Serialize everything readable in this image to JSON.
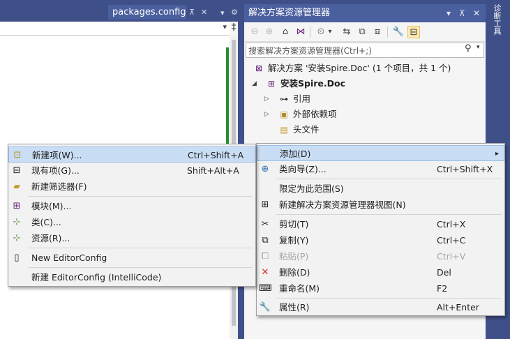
{
  "editor": {
    "tab_title": "packages.config",
    "pin_glyph": "⊼",
    "close_glyph": "✕",
    "tab_menu_glyph": "▾",
    "options_glyph": "⚙",
    "nav_dropdown_glyph": "▾",
    "split_glyph": "‡"
  },
  "solution_explorer": {
    "title": "解决方案资源管理器",
    "title_dropdown_glyph": "▾",
    "title_pin_glyph": "⊼",
    "title_close_glyph": "✕",
    "search_placeholder": "搜索解决方案资源管理器(Ctrl+;)",
    "search_icon_glyph": "⚲",
    "search_dropdown_glyph": "▾",
    "toolbar": {
      "back": "⊖",
      "forward": "⊕",
      "home": "⌂",
      "vs": "⋈",
      "dropdown1": "▾",
      "history": "⏲",
      "dropdown2": "▾",
      "sync": "⇆",
      "collapse": "⧉",
      "show_all": "⧈",
      "properties": "🔧",
      "preview": "⊟"
    },
    "tree": {
      "solution": "解决方案 '安装Spire.Doc' (1 个项目，共 1 个)",
      "project": "安装Spire.Doc",
      "references": "引用",
      "external_deps": "外部依赖项",
      "header_files": "头文件",
      "collapsed_arrow": "▷",
      "expanded_arrow": "◢",
      "icon_solution": "⊠",
      "icon_project": "⊞",
      "icon_refs": "⊶",
      "icon_extdeps": "▣",
      "icon_headers": "▤"
    }
  },
  "diagnostic_tab": "诊断工具",
  "context_menu": {
    "add": {
      "label": "添加(D)",
      "submenu_arrow": "▸"
    },
    "class_wizard": {
      "label": "类向导(Z)...",
      "shortcut": "Ctrl+Shift+X",
      "icon": "⊕"
    },
    "scope_here": {
      "label": "限定为此范围(S)"
    },
    "new_view": {
      "label": "新建解决方案资源管理器视图(N)",
      "icon": "⊞"
    },
    "cut": {
      "label": "剪切(T)",
      "shortcut": "Ctrl+X",
      "icon": "✂"
    },
    "copy": {
      "label": "复制(Y)",
      "shortcut": "Ctrl+C",
      "icon": "⧉"
    },
    "paste": {
      "label": "粘贴(P)",
      "shortcut": "Ctrl+V",
      "icon": "⧠"
    },
    "delete": {
      "label": "删除(D)",
      "shortcut": "Del",
      "icon": "✕"
    },
    "rename": {
      "label": "重命名(M)",
      "shortcut": "F2",
      "icon": "⌨"
    },
    "properties": {
      "label": "属性(R)",
      "shortcut": "Alt+Enter",
      "icon": "🔧"
    }
  },
  "add_submenu": {
    "new_item": {
      "label": "新建项(W)...",
      "shortcut": "Ctrl+Shift+A",
      "icon": "⊡"
    },
    "existing_item": {
      "label": "现有项(G)...",
      "shortcut": "Shift+Alt+A",
      "icon": "⊟"
    },
    "new_filter": {
      "label": "新建筛选器(F)",
      "icon": "▰"
    },
    "module": {
      "label": "模块(M)...",
      "icon": "⊞"
    },
    "class": {
      "label": "类(C)...",
      "icon": "⊹"
    },
    "resource": {
      "label": "资源(R)...",
      "icon": "⊹"
    },
    "editorconfig": {
      "label": "New EditorConfig",
      "icon": "▯"
    },
    "editorconfig_intellicode": {
      "label": "新建 EditorConfig (IntelliCode)"
    }
  }
}
